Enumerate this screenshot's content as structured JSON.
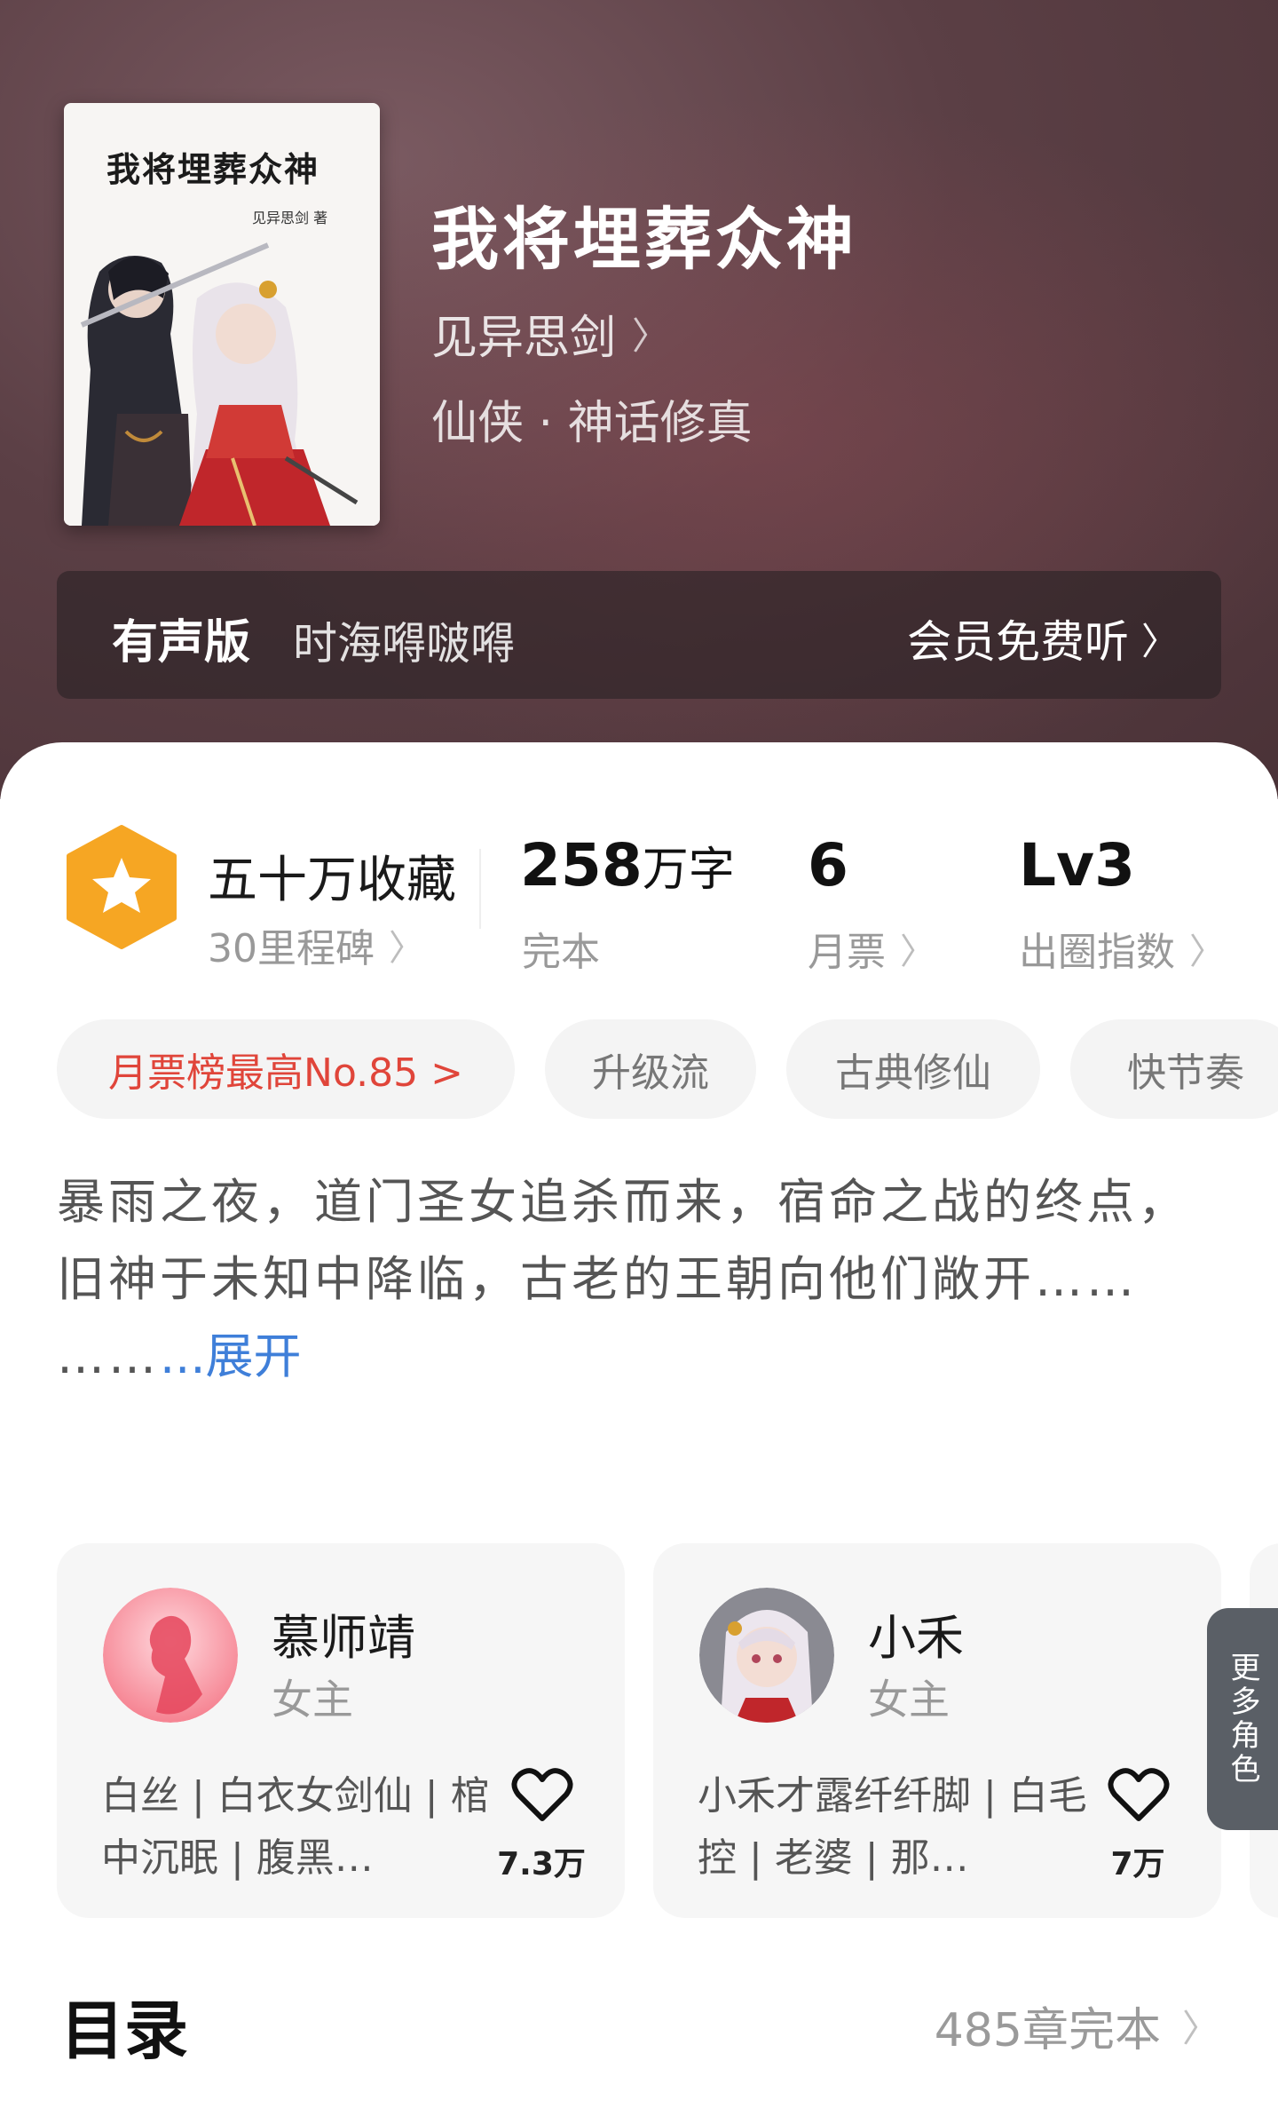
{
  "book": {
    "cover_title": "我将埋葬众神",
    "cover_author": "见异思剑 著",
    "title": "我将埋葬众神",
    "author": "见异思剑",
    "genre": "仙侠 · 神话修真"
  },
  "audio": {
    "label": "有声版",
    "narrator": "时海嘚啵嘚",
    "cta": "会员免费听"
  },
  "stats": {
    "collection_main": "五十万收藏",
    "collection_sub": "30里程碑",
    "words_num": "258",
    "words_unit": "万字",
    "words_sub": "完本",
    "votes_main": "6",
    "votes_sub": "月票",
    "level_main": "Lv3",
    "level_sub": "出圈指数"
  },
  "tags": [
    "月票榜最高No.85 >",
    "升级流",
    "古典修仙",
    "快节奏"
  ],
  "synopsis": {
    "text": "暴雨之夜，道门圣女追杀而来，宿命之战的终点，旧神于未知中降临，古老的王朝向他们敞开……\n……",
    "expand": "...展开"
  },
  "characters": [
    {
      "name": "慕师靖",
      "role": "女主",
      "tags": "白丝 | 白衣女剑仙 | 棺中沉眠 | 腹黑…",
      "likes": "7.3万"
    },
    {
      "name": "小禾",
      "role": "女主",
      "tags": "小禾才露纤纤脚 | 白毛控 | 老婆 | 那…",
      "likes": "7万"
    }
  ],
  "more_roles": "更多角色",
  "toc": {
    "title": "目录",
    "summary": "485章完本"
  },
  "colors": {
    "hero_bg": "#5b3f45",
    "accent_red": "#e0453a",
    "link_blue": "#3f7fd9",
    "badge_orange": "#f6a623"
  }
}
